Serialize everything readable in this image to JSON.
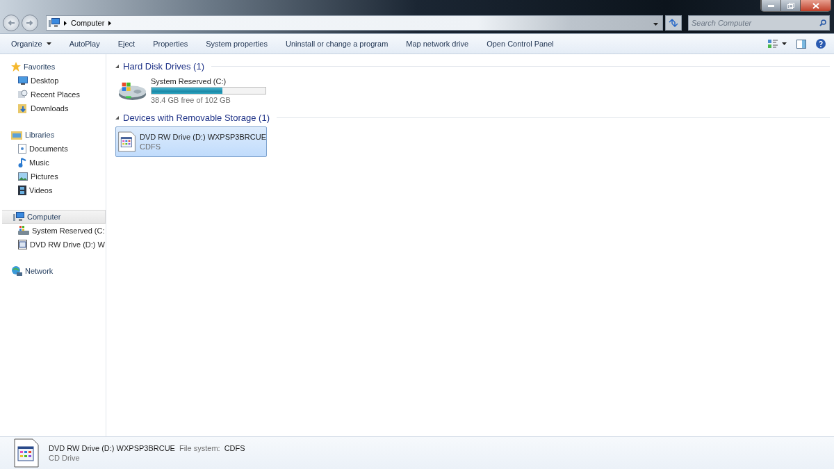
{
  "address": {
    "breadcrumb": [
      "Computer"
    ],
    "search": {
      "placeholder": "Search Computer"
    }
  },
  "toolbar": [
    {
      "label": "Organize",
      "kind": "menu"
    },
    {
      "label": "AutoPlay",
      "kind": "command"
    },
    {
      "label": "Eject",
      "kind": "command"
    },
    {
      "label": "Properties",
      "kind": "command"
    },
    {
      "label": "System properties",
      "kind": "command"
    },
    {
      "label": "Uninstall or change a program",
      "kind": "command"
    },
    {
      "label": "Map network drive",
      "kind": "command"
    },
    {
      "label": "Open Control Panel",
      "kind": "command"
    }
  ],
  "navigation": [
    {
      "label": "Favorites",
      "kind": "star",
      "selected": false,
      "children": [
        {
          "label": "Desktop",
          "kind": "desktop",
          "selected": false
        },
        {
          "label": "Recent Places",
          "kind": "places",
          "selected": false
        },
        {
          "label": "Downloads",
          "kind": "download",
          "selected": false
        }
      ]
    },
    {
      "label": "Libraries",
      "kind": "library",
      "selected": false,
      "children": [
        {
          "label": "Documents",
          "kind": "document",
          "selected": false
        },
        {
          "label": "Music",
          "kind": "music",
          "selected": false
        },
        {
          "label": "Pictures",
          "kind": "picture",
          "selected": false
        },
        {
          "label": "Videos",
          "kind": "video",
          "selected": false
        }
      ]
    },
    {
      "label": "Computer",
      "kind": "computer",
      "selected": true,
      "children": [
        {
          "label": "System Reserved (C:",
          "kind": "drive",
          "selected": false
        },
        {
          "label": "DVD RW Drive (D:) W",
          "kind": "disc",
          "selected": false
        }
      ]
    },
    {
      "label": "Network",
      "kind": "network",
      "selected": false
    }
  ],
  "groups": [
    {
      "title": "Hard Disk Drives (1)",
      "items": [
        {
          "kind": "drive",
          "name": "System Reserved (C:)",
          "level": 0.62,
          "detail": "38.4 GB free of 102 GB",
          "selected": false
        }
      ]
    },
    {
      "title": "Devices with Removable Storage (1)",
      "items": [
        {
          "kind": "disc",
          "name": "DVD RW Drive (D:) WXPSP3BRCUE",
          "detail": "CDFS",
          "selected": true
        }
      ]
    }
  ],
  "details": {
    "name": "DVD RW Drive (D:) WXPSP3BRCUE",
    "field_label": "File system:",
    "field_value": "CDFS",
    "type": "CD Drive"
  }
}
